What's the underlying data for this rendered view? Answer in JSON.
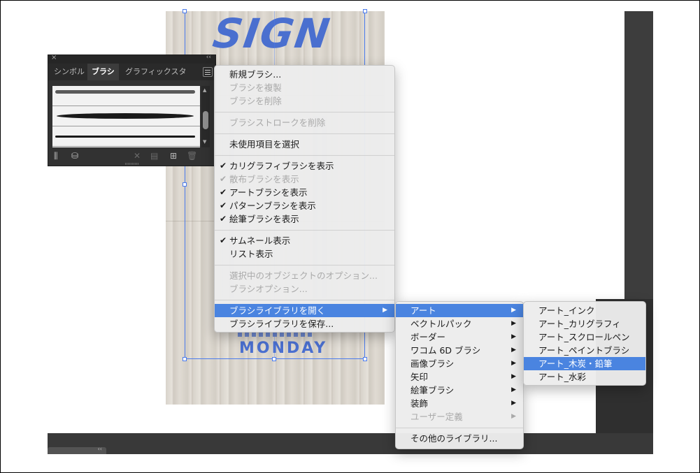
{
  "panel": {
    "tabs": [
      "シンボル",
      "ブラシ",
      "グラフィックスタ"
    ],
    "active_tab": "ブラシ"
  },
  "artwork": {
    "headline": "SIGN",
    "footer": "MONDAY"
  },
  "context_menu": {
    "new_brush": "新規ブラシ...",
    "duplicate_brush": "ブラシを複製",
    "delete_brush": "ブラシを削除",
    "remove_brush_stroke": "ブラシストロークを削除",
    "select_unused": "未使用項目を選択",
    "show_calligraphic": "カリグラフィブラシを表示",
    "show_scatter": "散布ブラシを表示",
    "show_art": "アートブラシを表示",
    "show_pattern": "パターンブラシを表示",
    "show_bristle": "絵筆ブラシを表示",
    "thumbnail_view": "サムネール表示",
    "list_view": "リスト表示",
    "selected_object_options": "選択中のオブジェクトのオプション...",
    "brush_options": "ブラシオプション...",
    "open_brush_library": "ブラシライブラリを開く",
    "save_brush_library": "ブラシライブラリを保存..."
  },
  "library_menu": {
    "art": "アート",
    "vector_packs": "ベクトルパック",
    "borders": "ボーダー",
    "wacom": "ワコム 6D ブラシ",
    "image_brushes": "画像ブラシ",
    "arrows": "矢印",
    "bristle_brush": "絵筆ブラシ",
    "decorative": "装飾",
    "user_defined": "ユーザー定義",
    "other_library": "その他のライブラリ..."
  },
  "art_menu": {
    "ink": "アート_インク",
    "calligraphic": "アート_カリグラフィ",
    "scroll_pen": "アート_スクロールペン",
    "paint_brush": "アート_ペイントブラシ",
    "charcoal_pencil": "アート_木炭・鉛筆",
    "watercolor": "アート_水彩"
  },
  "colors": {
    "highlight": "#4a84e0",
    "panel_bg": "#323232",
    "artwork_blue": "#4a6fcf"
  }
}
